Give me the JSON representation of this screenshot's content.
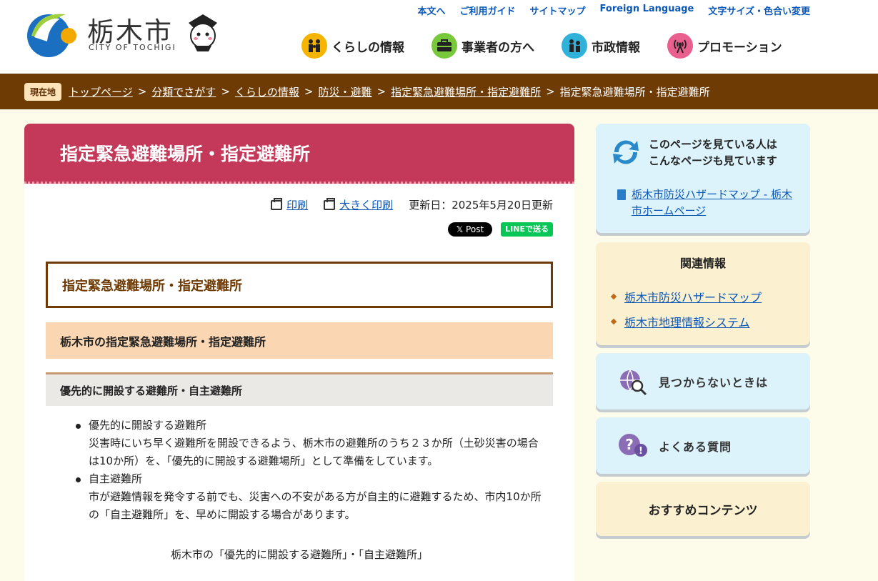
{
  "header": {
    "logo_text": "栃木市",
    "logo_sub": "CITY OF TOCHIGI",
    "util_links": [
      "本文へ",
      "ご利用ガイド",
      "サイトマップ",
      "Foreign Language",
      "文字サイズ・色合い変更"
    ],
    "gnav": [
      {
        "label": "くらしの情報",
        "color": "#f5b400",
        "icon": "family-icon"
      },
      {
        "label": "事業者の方へ",
        "color": "#78c83c",
        "icon": "briefcase-icon"
      },
      {
        "label": "市政情報",
        "color": "#2fb1d9",
        "icon": "people-icon"
      },
      {
        "label": "プロモーション",
        "color": "#e95f8e",
        "icon": "broadcast-icon"
      }
    ]
  },
  "breadcrumb": {
    "badge": "現在地",
    "items": [
      "トップページ",
      "分類でさがす",
      "くらしの情報",
      "防災・避難",
      "指定緊急避難場所・指定避難所"
    ],
    "current": "指定緊急避難場所・指定避難所",
    "separator": ">"
  },
  "main": {
    "title": "指定緊急避難場所・指定避難所",
    "print_label": "印刷",
    "print_large_label": "大きく印刷",
    "updated": "更新日：2025年5月20日更新",
    "x_post": "𝕏 Post",
    "line_share": "LINEで送る",
    "h2": "指定緊急避難場所・指定避難所",
    "h3": "栃木市の指定緊急避難場所・指定避難所",
    "h4": "優先的に開設する避難所・自主避難所",
    "list": [
      {
        "title": "優先的に開設する避難所",
        "desc": "災害時にいち早く避難所を開設できるよう、栃木市の避難所のうち２３か所（土砂災害の場合は10か所）を、「優先的に開設する避難場所」として準備をしています。"
      },
      {
        "title": "自主避難所",
        "desc": "市が避難情報を発令する前でも、災害への不安がある方が自主的に避難するため、市内10か所の「自主避難所」を、早めに開設する場合があります。"
      }
    ],
    "caption": "栃木市の「優先的に開設する避難所」・「自主避難所」"
  },
  "sidebar": {
    "viewed_heading_1": "このページを見ている人は",
    "viewed_heading_2": "こんなページも見ています",
    "viewed_link": "栃木市防災ハザードマップ - 栃木市ホームページ",
    "related_heading": "関連情報",
    "related_links": [
      "栃木市防災ハザードマップ",
      "栃木市地理情報システム"
    ],
    "not_found": "見つからないときは",
    "faq": "よくある質問",
    "recommended": "おすすめコンテンツ"
  },
  "colors": {
    "brown": "#6e3b04",
    "title_red": "#c4385a",
    "link": "#0b57b8"
  }
}
